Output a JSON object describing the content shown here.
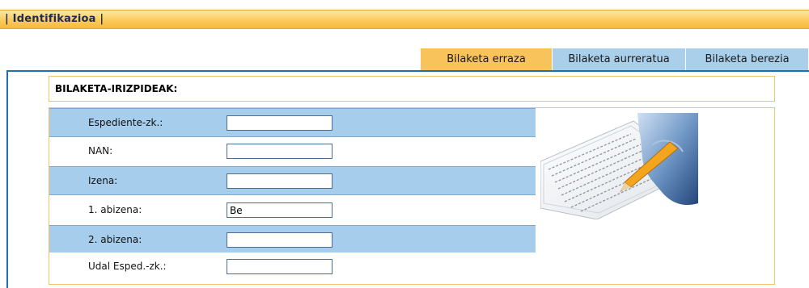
{
  "header": {
    "title": "| Identifikazioa |"
  },
  "tabs": [
    {
      "label": "Bilaketa erraza",
      "active": true
    },
    {
      "label": "Bilaketa aurreratua",
      "active": false
    },
    {
      "label": "Bilaketa berezia",
      "active": false
    }
  ],
  "criteria": {
    "heading": "BILAKETA-IRIZPIDEAK:"
  },
  "form": {
    "fields": [
      {
        "label": "Espediente-zk.:",
        "value": ""
      },
      {
        "label": "NAN:",
        "value": ""
      },
      {
        "label": "Izena:",
        "value": ""
      },
      {
        "label": "1. abizena:",
        "value": "Be"
      },
      {
        "label": "2. abizena:",
        "value": ""
      },
      {
        "label": "Udal Esped.-zk.:",
        "value": ""
      }
    ]
  },
  "colors": {
    "accent_orange": "#f9c35c",
    "tab_blue": "#a9cfea",
    "row_blue": "#a6cdeb",
    "frame_blue": "#1f6fb4"
  },
  "illustration": {
    "icon": "document-with-pen-icon"
  }
}
